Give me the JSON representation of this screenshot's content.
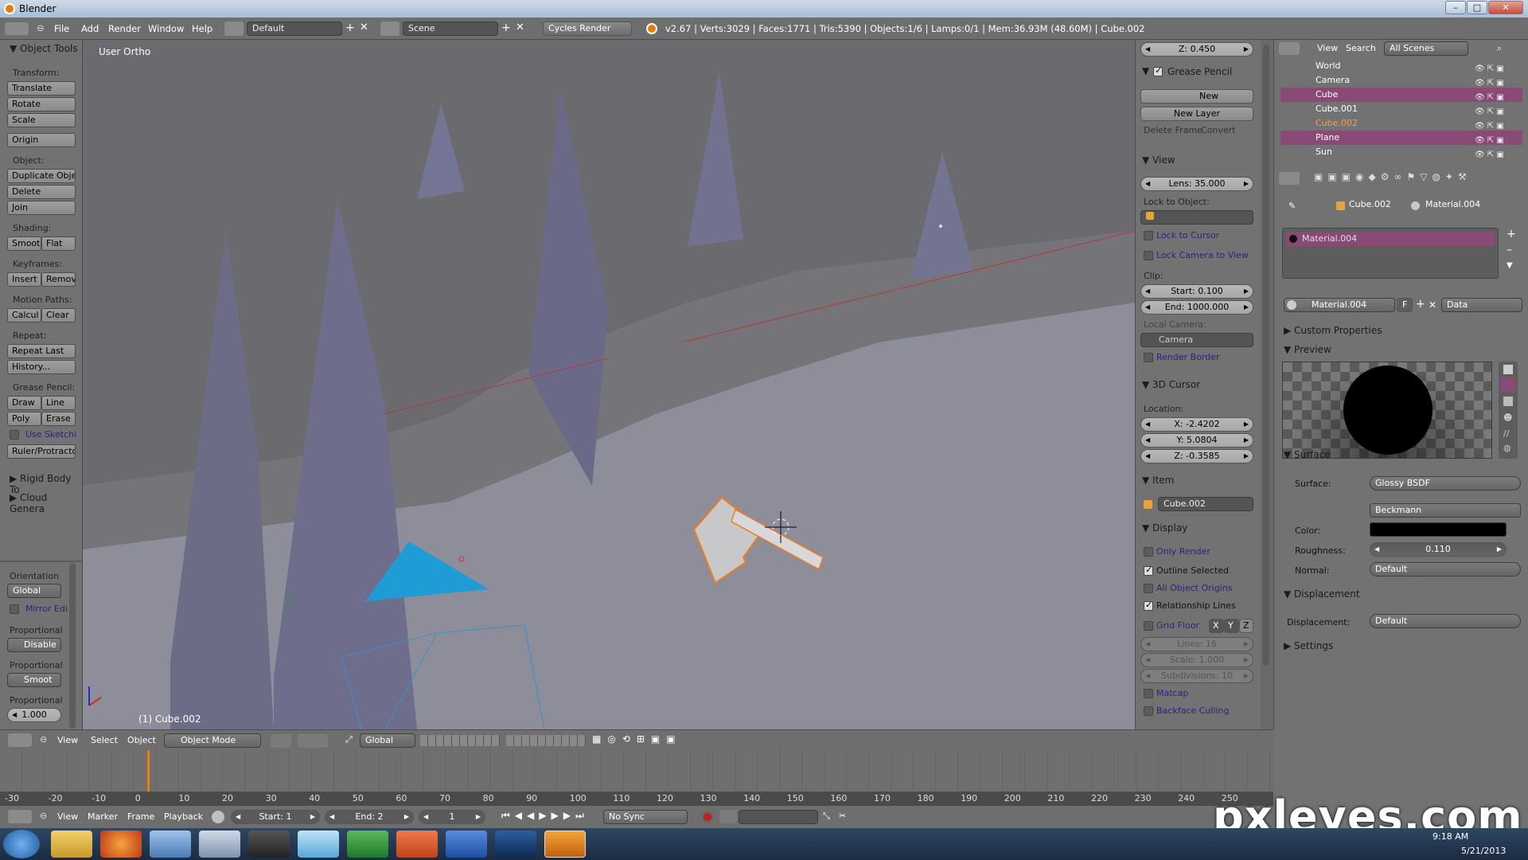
{
  "window": {
    "title": "Blender"
  },
  "infobar": {
    "menus": [
      "File",
      "Add",
      "Render",
      "Window",
      "Help"
    ],
    "layout": "Default",
    "scene": "Scene",
    "engine": "Cycles Render",
    "stats": "v2.67 | Verts:3029 | Faces:1771 | Tris:5390 | Objects:1/6 | Lamps:0/1 | Mem:36.93M (48.60M) | Cube.002"
  },
  "toolshelf": {
    "header": "Object Tools",
    "transform_label": "Transform:",
    "translate": "Translate",
    "rotate": "Rotate",
    "scale": "Scale",
    "origin": "Origin",
    "object_label": "Object:",
    "duplicate": "Duplicate Objec",
    "delete": "Delete",
    "join": "Join",
    "shading_label": "Shading:",
    "smooth": "Smoot",
    "flat": "Flat",
    "keyframes_label": "Keyframes:",
    "insert": "Insert",
    "remove": "Remov",
    "motion_label": "Motion Paths:",
    "calc": "Calcul",
    "clear": "Clear",
    "repeat_label": "Repeat:",
    "repeat_last": "Repeat Last",
    "history": "History...",
    "grease_label": "Grease Pencil:",
    "draw": "Draw",
    "line": "Line",
    "poly": "Poly",
    "erase": "Erase",
    "use_sketch": "Use Sketchi",
    "ruler": "Ruler/Protractor",
    "rigid": "Rigid Body To",
    "cloud": "Cloud Genera",
    "orientation_label": "Orientation",
    "orientation_val": "Global",
    "mirror": "Mirror Edi",
    "proportional_label": "Proportional",
    "proportional_val": "Disable",
    "proportional2_label": "Proportional",
    "proportional2_val": "Smoot",
    "proportional3_label": "Proportional",
    "proportional3_val": "1.000"
  },
  "viewport": {
    "view_name": "User Ortho",
    "object_name": "(1) Cube.002"
  },
  "npanel": {
    "z_top": "Z: 0.450",
    "grease_header": "Grease Pencil",
    "new": "New",
    "new_layer": "New Layer",
    "delete_frame": "Delete Frame",
    "convert": "Convert",
    "view_header": "View",
    "lens": "Lens: 35.000",
    "lock_obj_label": "Lock to Object:",
    "lock_cursor": "Lock to Cursor",
    "lock_camera": "Lock Camera to View",
    "clip_label": "Clip:",
    "clip_start": "Start: 0.100",
    "clip_end": "End: 1000.000",
    "local_camera_label": "Local Camera:",
    "camera": "Camera",
    "render_border": "Render Border",
    "cursor_header": "3D Cursor",
    "location_label": "Location:",
    "cx": "X: -2.4202",
    "cy": "Y: 5.0804",
    "cz": "Z: -0.3585",
    "item_header": "Item",
    "item_name": "Cube.002",
    "display_header": "Display",
    "only_render": "Only Render",
    "outline_selected": "Outline Selected",
    "all_origins": "All Object Origins",
    "relationship_lines": "Relationship Lines",
    "grid_floor": "Grid Floor",
    "gx": "X",
    "gy": "Y",
    "gz": "Z",
    "lines": "Lines: 16",
    "gscale": "Scale: 1.000",
    "subdivisions": "Subdivisions: 10",
    "matcap": "Matcap",
    "backface": "Backface Culling"
  },
  "outliner": {
    "view": "View",
    "search": "Search",
    "scenes": "All Scenes",
    "items": [
      "World",
      "Camera",
      "Cube",
      "Cube.001",
      "Cube.002",
      "Plane",
      "Sun"
    ]
  },
  "properties": {
    "breadcrumb_obj": "Cube.002",
    "breadcrumb_mat": "Material.004",
    "slot": "Material.004",
    "mat_name": "Material.004",
    "mat_f": "F",
    "mat_data": "Data",
    "custom_props": "Custom Properties",
    "preview": "Preview",
    "surface_header": "Surface",
    "surface_label": "Surface:",
    "surface_val": "Glossy BSDF",
    "distribution": "Beckmann",
    "color_label": "Color:",
    "roughness_label": "Roughness:",
    "roughness_val": "0.110",
    "normal_label": "Normal:",
    "normal_val": "Default",
    "displacement_header": "Displacement",
    "displacement_label": "Displacement:",
    "displacement_val": "Default",
    "settings": "Settings"
  },
  "vheader": {
    "view": "View",
    "select": "Select",
    "object": "Object",
    "mode": "Object Mode",
    "orientation": "Global"
  },
  "timeline": {
    "ticks": [
      "-30",
      "-20",
      "-10",
      "0",
      "10",
      "20",
      "30",
      "40",
      "50",
      "60",
      "70",
      "80",
      "90",
      "100",
      "110",
      "120",
      "130",
      "140",
      "150",
      "160",
      "170",
      "180",
      "190",
      "200",
      "210",
      "220",
      "230",
      "240",
      "250"
    ],
    "current_frame": 1
  },
  "tlheader": {
    "view": "View",
    "marker": "Marker",
    "frame": "Frame",
    "playback": "Playback",
    "start": "Start: 1",
    "end": "End: 2",
    "frame_val": "1",
    "sync": "No Sync"
  },
  "taskbar": {
    "time": "9:18 AM",
    "date": "5/21/2013"
  },
  "watermark": "pxleyes.com"
}
